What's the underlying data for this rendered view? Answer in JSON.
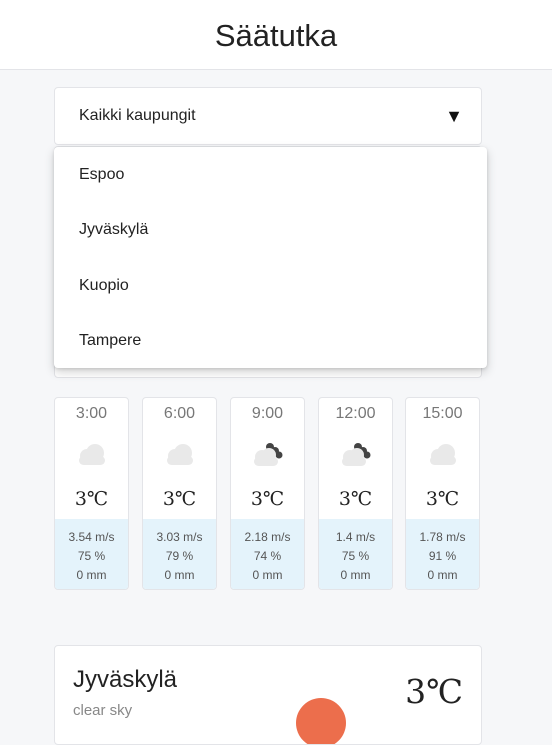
{
  "header": {
    "title": "Säätutka"
  },
  "city_select": {
    "selected": "Kaikki kaupungit",
    "options": [
      "Espoo",
      "Jyväskylä",
      "Kuopio",
      "Tampere"
    ]
  },
  "forecast": [
    {
      "time": "3:00",
      "icon": "cloud-icon",
      "temp": "3℃",
      "wind": "3.54 m/s",
      "humidity": "75 %",
      "precip": "0 mm"
    },
    {
      "time": "6:00",
      "icon": "cloud-icon",
      "temp": "3℃",
      "wind": "3.03 m/s",
      "humidity": "79 %",
      "precip": "0 mm"
    },
    {
      "time": "9:00",
      "icon": "dark-cloud-icon",
      "temp": "3℃",
      "wind": "2.18 m/s",
      "humidity": "74 %",
      "precip": "0 mm"
    },
    {
      "time": "12:00",
      "icon": "dark-cloud-icon",
      "temp": "3℃",
      "wind": "1.4 m/s",
      "humidity": "75 %",
      "precip": "0 mm"
    },
    {
      "time": "15:00",
      "icon": "cloud-icon",
      "temp": "3℃",
      "wind": "1.78 m/s",
      "humidity": "91 %",
      "precip": "0 mm"
    }
  ],
  "city_card": {
    "name": "Jyväskylä",
    "description": "clear sky",
    "temp": "3℃",
    "icon": "sun-icon"
  },
  "colors": {
    "sun": "#ec6e4c",
    "details_bg": "#e4f3fb"
  }
}
